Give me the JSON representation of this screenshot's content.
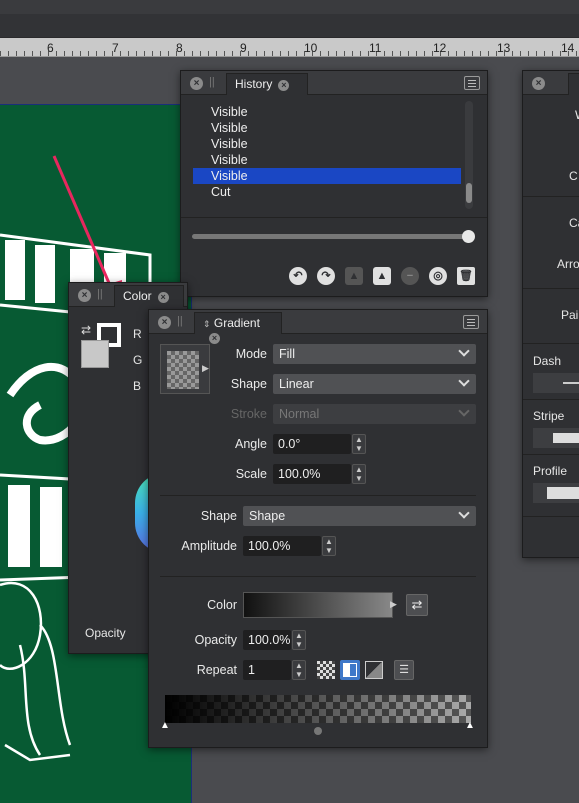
{
  "ruler": {
    "numbers": [
      "6",
      "7",
      "8",
      "9",
      "10",
      "11",
      "12",
      "13",
      "14"
    ]
  },
  "history_panel": {
    "tab_label": "History",
    "items": [
      "Visible",
      "Visible",
      "Visible",
      "Visible",
      "Visible",
      "Cut"
    ],
    "selected_index": 4,
    "slider_fraction": 1.0,
    "actions": [
      "undo-icon",
      "redo-icon",
      "snapshot-icon",
      "image-icon",
      "remove-icon",
      "zoom-to-icon",
      "delete-icon"
    ]
  },
  "color_panel": {
    "tab_label": "Color",
    "channels": [
      "R",
      "G",
      "B"
    ],
    "opacity_label": "Opacity"
  },
  "gradient_panel": {
    "tab_label": "Gradient",
    "mode_label": "Mode",
    "mode_value": "Fill",
    "shape_label": "Shape",
    "shape_value": "Linear",
    "stroke_label": "Stroke",
    "stroke_value": "Normal",
    "angle_label": "Angle",
    "angle_value": "0.0°",
    "scale_label": "Scale",
    "scale_value": "100.0%",
    "shape2_label": "Shape",
    "shape2_value": "Shape",
    "amplitude_label": "Amplitude",
    "amplitude_value": "100.0%",
    "color_label": "Color",
    "opacity_label": "Opacity",
    "opacity_value": "100.0%",
    "repeat_label": "Repeat",
    "repeat_value": "1"
  },
  "right_panel": {
    "dash_label": "Dash",
    "stripe_label": "Stripe",
    "profile_label": "Profile",
    "partial_labels": [
      "W",
      "C",
      "Ca",
      "Arro",
      "Pai"
    ]
  },
  "colors": {
    "artboard": "#075a33",
    "selection": "#1a47c4",
    "annotation_arrow": "#e8275e"
  }
}
